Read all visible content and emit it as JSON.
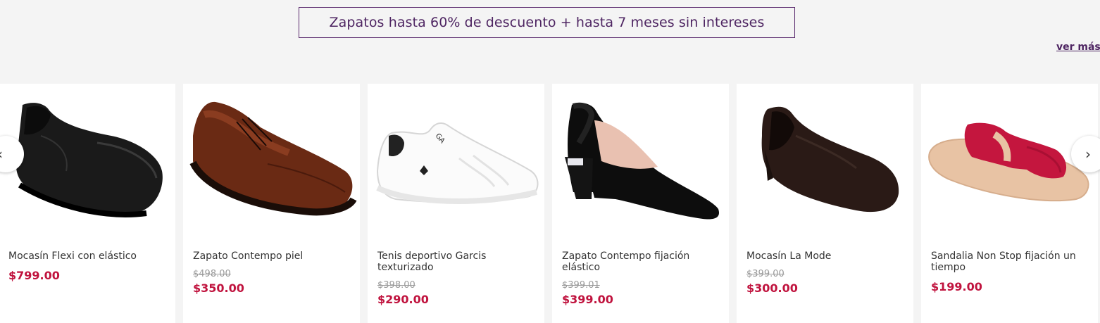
{
  "banner": {
    "text": "Zapatos hasta 60% de descuento + hasta 7 meses sin intereses"
  },
  "see_more": {
    "label": "ver más"
  },
  "carousel": {
    "prev_glyph": "‹",
    "next_glyph": "›",
    "products": [
      {
        "name": "Mocasín Flexi con elástico",
        "old_price": "",
        "price": "$799.00",
        "image": "black-loafer"
      },
      {
        "name": "Zapato Contempo piel",
        "old_price": "$498.00",
        "price": "$350.00",
        "image": "brown-oxford"
      },
      {
        "name": "Tenis deportivo Garcis texturizado",
        "old_price": "$398.00",
        "price": "$290.00",
        "image": "white-sneaker"
      },
      {
        "name": "Zapato Contempo fijación elástico",
        "old_price": "$399.01",
        "price": "$399.00",
        "image": "black-slingback"
      },
      {
        "name": "Mocasín La Mode",
        "old_price": "$399.00",
        "price": "$300.00",
        "image": "dark-brown-loafer"
      },
      {
        "name": "Sandalia Non Stop fijación un tiempo",
        "old_price": "",
        "price": "$199.00",
        "image": "red-sandal"
      }
    ]
  },
  "colors": {
    "brand": "#4e2562",
    "price": "#c0133e",
    "old_price": "#9a9a9a",
    "background": "#f4f4f4"
  }
}
